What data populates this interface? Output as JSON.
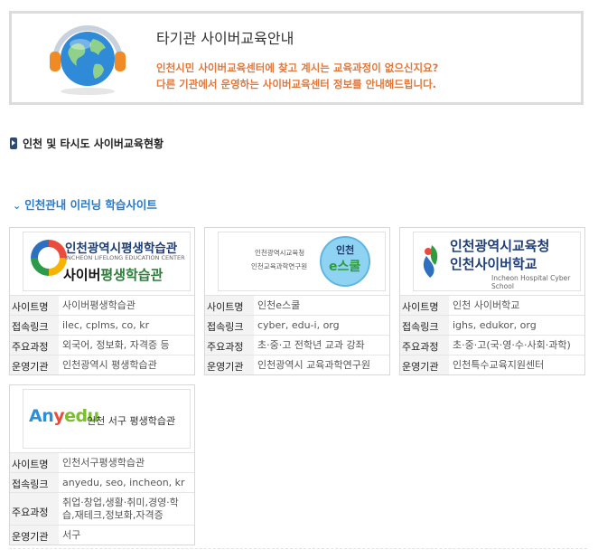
{
  "banner": {
    "title": "타기관 사이버교육안내",
    "desc_line1": "인천시민 사이버교육센터에 찾고 계시는 교육과정이 없으신지요?",
    "desc_line2": "다른 기관에서 운영하는 사이버교육센터 정보를 안내해드립니다."
  },
  "section1": {
    "label": "인천 및 타시도 사이버교육현황"
  },
  "section2": {
    "label": "인천관내 이러닝 학습사이트"
  },
  "labels": {
    "site": "사이트명",
    "link": "접속링크",
    "course": "주요과정",
    "org": "운영기관"
  },
  "cards": [
    {
      "logo": {
        "line1": "인천광역시평생학습관",
        "line2": "INCHEON LIFELONG EDUCATION CENTER",
        "line3a": "사이버",
        "line3b": "평생학습관"
      },
      "site": "사이버평생학습관",
      "link": "ilec, cplms, co, kr",
      "course": "외국어, 정보화, 자격증 등",
      "org": "인천광역시 평생학습관"
    },
    {
      "logo": {
        "line1": "인천광역시교육청",
        "line2": "인천교육과학연구원",
        "disc_top": "인천",
        "disc_main": "e스쿨"
      },
      "site": "인천e스쿨",
      "link": "cyber, edu-i, org",
      "course": "초·중·고 전학년 교과 강좌",
      "org": "인천광역시 교육과학연구원"
    },
    {
      "logo": {
        "line1": "인천광역시교육청",
        "line2": "인천사이버학교",
        "line3": "Incheon Hospital Cyber School"
      },
      "site": "인천 사이버학교",
      "link": "ighs, edukor, org",
      "course": "초·중·고(국·영·수·사회·과학)",
      "org": "인천특수교육지원센터"
    },
    {
      "logo": {
        "brand_a": "An",
        "brand_y": "y",
        "brand_edu": "edu",
        "sub": "인천 서구 평생학습관"
      },
      "site": "인천서구평생학습관",
      "link": "anyedu, seo, incheon, kr",
      "course_line1": "취업·창업,생활·취미,경영·학",
      "course_line2": "습,재테크,정보화,자격증",
      "org": "서구"
    }
  ],
  "colors": {
    "accent_orange": "#e0783c",
    "link_blue": "#2b78c2",
    "navy": "#2e4a6e"
  }
}
